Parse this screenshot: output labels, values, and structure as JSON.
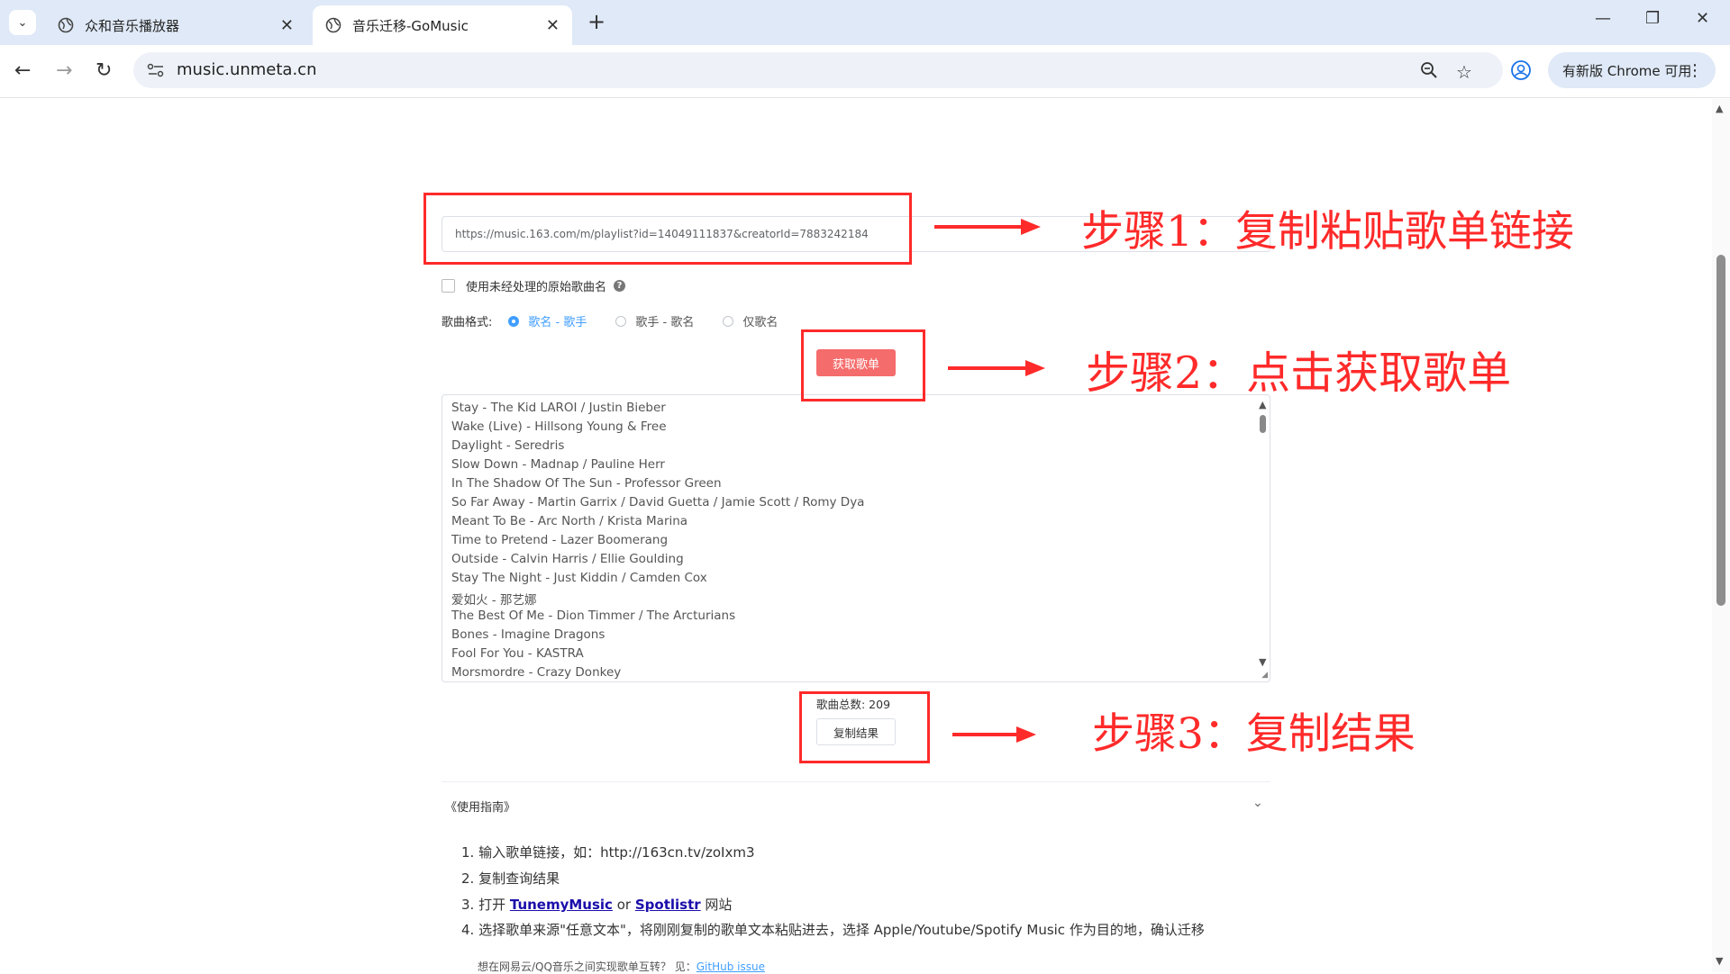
{
  "browser": {
    "tabs": [
      {
        "title": "众和音乐播放器",
        "active": false
      },
      {
        "title": "音乐迁移-GoMusic",
        "active": true
      }
    ],
    "url": "music.unmeta.cn",
    "update_label": "有新版 Chrome 可用"
  },
  "form": {
    "playlist_url": "https://music.163.com/m/playlist?id=14049111837&creatorId=7883242184",
    "raw_name_label": "使用未经处理的原始歌曲名",
    "format_label": "歌曲格式:",
    "format_options": [
      "歌名 - 歌手",
      "歌手 - 歌名",
      "仅歌名"
    ],
    "selected_format": "歌名 - 歌手",
    "fetch_label": "获取歌单"
  },
  "songs": [
    "Stay - The Kid LAROI / Justin Bieber",
    "Wake (Live) - Hillsong Young & Free",
    "Daylight - Seredris",
    "Slow Down - Madnap / Pauline Herr",
    "In The Shadow Of The Sun - Professor Green",
    "So Far Away - Martin Garrix / David Guetta / Jamie Scott / Romy Dya",
    "Meant To Be - Arc North / Krista Marina",
    "Time to Pretend - Lazer Boomerang",
    "Outside - Calvin Harris / Ellie Goulding",
    "Stay The Night - Just Kiddin / Camden Cox",
    "爱如火 - 那艺娜",
    "The Best Of Me - Dion Timmer / The Arcturians",
    "Bones - Imagine Dragons",
    "Fool For You - KASTRA",
    "Morsmordre - Crazy Donkey"
  ],
  "result": {
    "count_label": "歌曲总数: 209",
    "copy_label": "复制结果"
  },
  "guide": {
    "title": "《使用指南》",
    "item1": "1. 输入歌单链接，如：http://163cn.tv/zoIxm3",
    "item2": "2. 复制查询结果",
    "item3_prefix": "3. 打开 ",
    "item3_link1": "TunemyMusic",
    "item3_or": " or ",
    "item3_link2": "Spotlistr",
    "item3_suffix": " 网站",
    "item4": "4. 选择歌单来源\"任意文本\"，将刚刚复制的歌单文本粘贴进去，选择 Apple/Youtube/Spotify Music 作为目的地，确认迁移",
    "note_prefix": "想在网易云/QQ音乐之间实现歌单互转？ 见：",
    "note_link": "GitHub issue"
  },
  "annotations": {
    "step1": "步骤1：复制粘贴歌单链接",
    "step2": "步骤2：点击获取歌单",
    "step3": "步骤3：复制结果"
  }
}
